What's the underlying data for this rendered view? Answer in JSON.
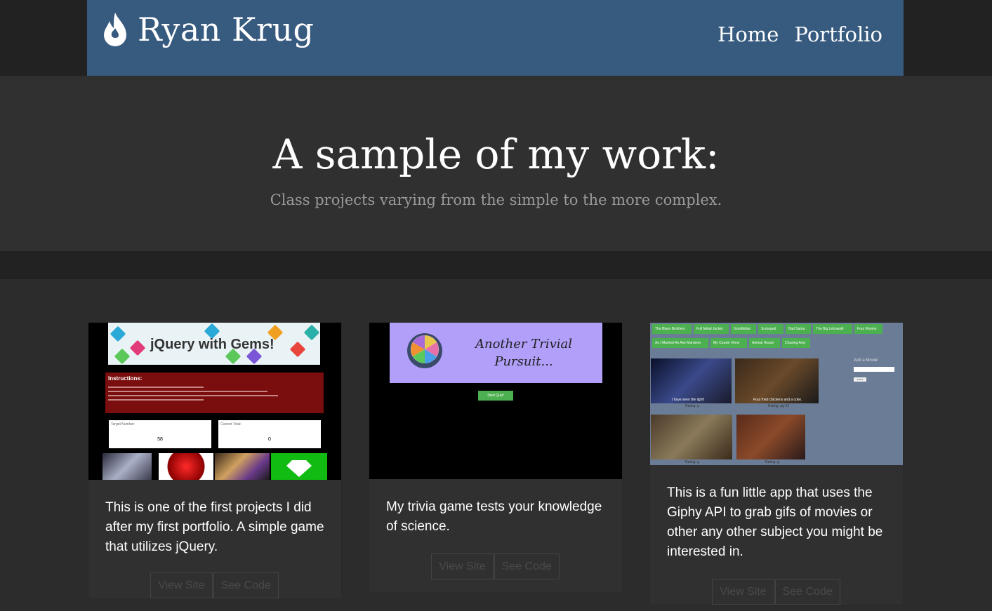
{
  "navbar": {
    "brand": "Ryan Krug",
    "links": [
      "Home",
      "Portfolio"
    ]
  },
  "hero": {
    "title": "A sample of my work:",
    "subtitle": "Class projects varying from the simple to the more complex."
  },
  "cards": [
    {
      "description": "This is one of the first projects I did after my first portfolio. A simple game that utilizes jQuery.",
      "view_label": "View Site",
      "code_label": "See Code",
      "screenshot": {
        "banner_title": "jQuery with Gems!",
        "instructions_title": "Instructions:",
        "target_label": "Target Number:",
        "target_value": "58",
        "current_label": "Current Total:",
        "current_value": "0"
      }
    },
    {
      "description": "My trivia game tests your knowledge of science.",
      "view_label": "View Site",
      "code_label": "See Code",
      "screenshot": {
        "title": "Another Trivial Pursuit...",
        "start_button": "Start Quiz!"
      }
    },
    {
      "description": "This is a fun little app that uses the Giphy API to grab gifs of movies or other any other subject you might be interested in.",
      "view_label": "View Site",
      "code_label": "See Code",
      "screenshot": {
        "tags": [
          "The Blues Brothers",
          "Full Metal Jacket",
          "Goodfellas",
          "Scrooged",
          "Bad Santa",
          "The Big Lebowski",
          "Four Rooms",
          "As I Married An Axe Murderer",
          "My Cousin Vinny",
          "Animal House",
          "Chasing Amy"
        ],
        "add_label": "Add a Movie!",
        "submit_label": "submit",
        "ratings": [
          "Rating: g",
          "Rating: pg-13",
          "Rating: g",
          "Rating: g"
        ],
        "captions": [
          "I have seen the light!",
          "Four fried chickens and a coke."
        ]
      }
    }
  ],
  "colors": {
    "navbar": "#375a7f",
    "background": "#2c2c2c",
    "hero": "#303030"
  }
}
